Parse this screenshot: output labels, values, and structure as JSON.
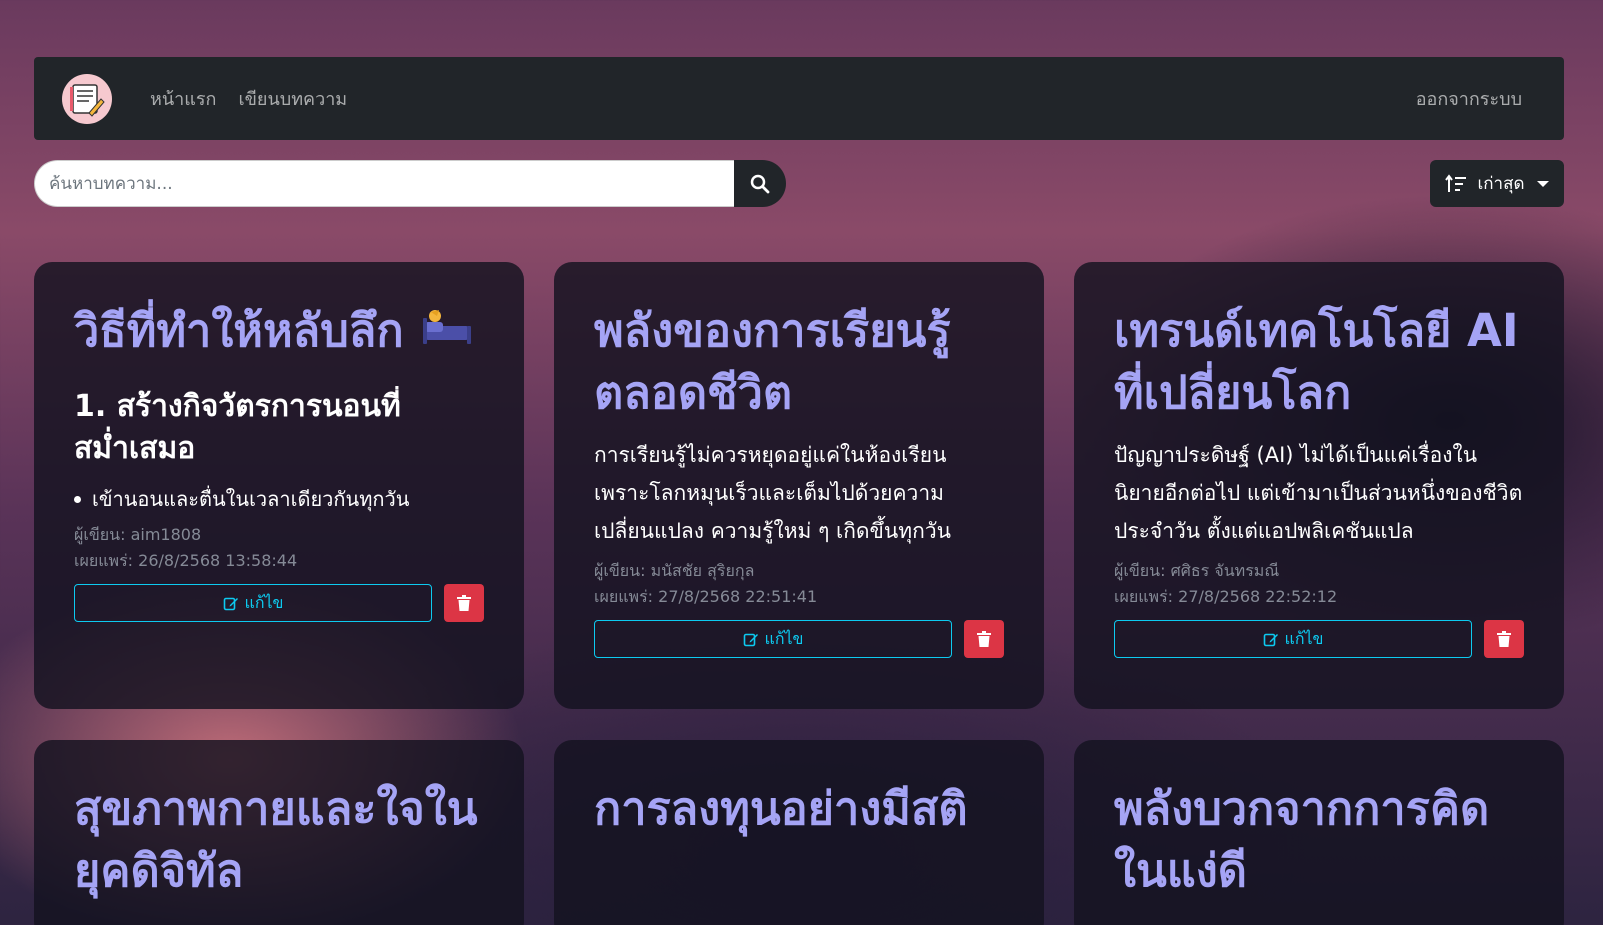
{
  "nav": {
    "logo": "blog-logo",
    "links": [
      "หน้าแรก",
      "เขียนบทความ"
    ],
    "logout": "ออกจากระบบ"
  },
  "search": {
    "placeholder": "ค้นหาบทความ...",
    "icon": "search-icon"
  },
  "sort": {
    "label": "เก่าสุด",
    "icon": "sort-ascending-icon"
  },
  "articles": [
    {
      "title": "วิธีที่ทำให้หลับลึก",
      "title_icon": "bed-icon",
      "excerpt_heading": "1. สร้างกิจวัตรการนอนที่สม่ำเสมอ",
      "excerpt_item": "เข้านอนและตื่นในเวลาเดียวกันทุกวัน",
      "author": "ผู้เขียน: aim1808",
      "published": "เผยแพร่: 26/8/2568 13:58:44",
      "edit_label": "แก้ไข"
    },
    {
      "title": "พลังของการเรียนรู้ตลอดชีวิต",
      "excerpt": "การเรียนรู้ไม่ควรหยุดอยู่แค่ในห้องเรียน เพราะโลกหมุนเร็วและเต็มไปด้วยความเปลี่ยนแปลง ความรู้ใหม่ ๆ เกิดขึ้นทุกวัน",
      "author": "ผู้เขียน: มนัสชัย สุริยกุล",
      "published": "เผยแพร่: 27/8/2568 22:51:41",
      "edit_label": "แก้ไข"
    },
    {
      "title": "เทรนด์เทคโนโลยี AI ที่เปลี่ยนโลก",
      "excerpt": "ปัญญาประดิษฐ์ (AI) ไม่ได้เป็นแค่เรื่องในนิยายอีกต่อไป แต่เข้ามาเป็นส่วนหนึ่งของชีวิตประจำวัน ตั้งแต่แอปพลิเคชันแปล",
      "author": "ผู้เขียน: ศศิธร จันทรมณี",
      "published": "เผยแพร่: 27/8/2568 22:52:12",
      "edit_label": "แก้ไข"
    },
    {
      "title": "สุขภาพกายและใจในยุคดิจิทัล"
    },
    {
      "title": "การลงทุนอย่างมีสติ"
    },
    {
      "title": "พลังบวกจากการคิดในแง่ดี"
    }
  ],
  "colors": {
    "title": "#a5a4f5",
    "edit_outline": "#0dcaf0",
    "delete": "#dc3545",
    "navbar": "#212529"
  }
}
